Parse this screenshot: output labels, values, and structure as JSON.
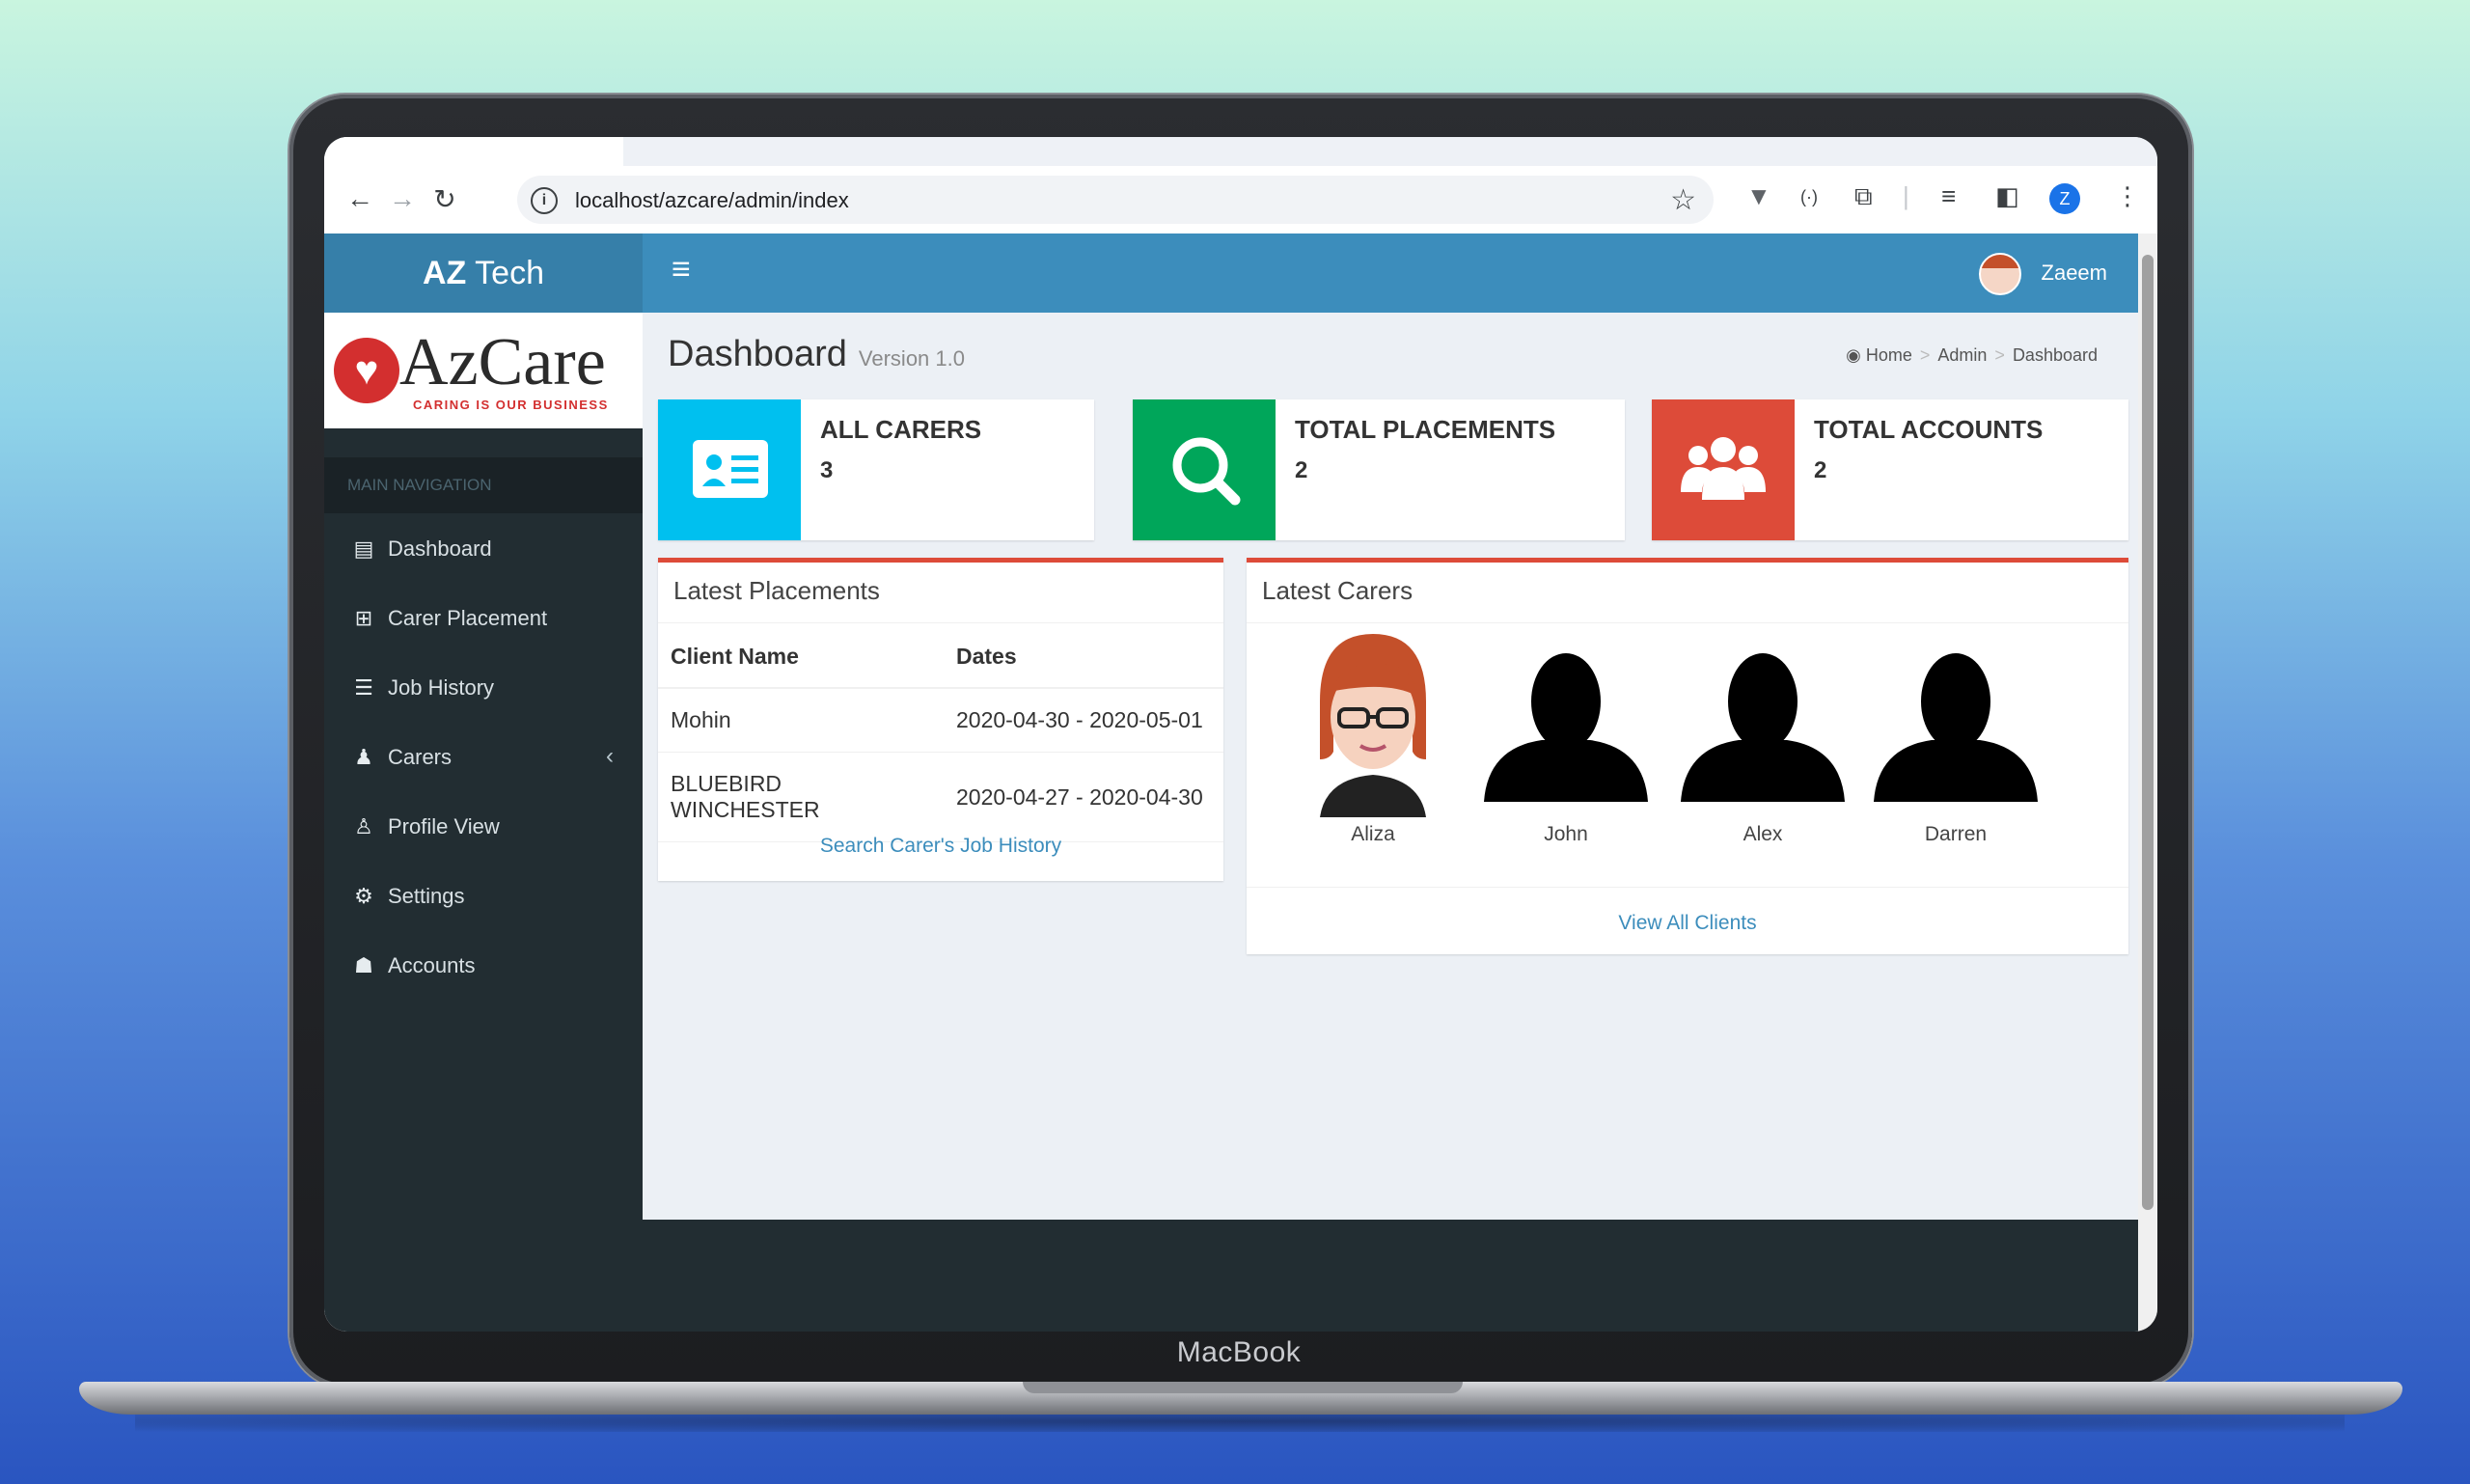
{
  "device": {
    "label": "MacBook"
  },
  "browser": {
    "url": "localhost/azcare/admin/index",
    "profile_initial": "Z"
  },
  "app": {
    "brand_bold": "AZ",
    "brand_rest": "Tech",
    "user_name": "Zaeem",
    "logo": {
      "name": "AzCare",
      "tagline": "CARING IS OUR BUSINESS"
    },
    "nav_header": "MAIN NAVIGATION",
    "menu": [
      {
        "label": "Dashboard",
        "icon": "book-icon"
      },
      {
        "label": "Carer Placement",
        "icon": "plus-square-icon"
      },
      {
        "label": "Job History",
        "icon": "list-icon"
      },
      {
        "label": "Carers",
        "icon": "user-icon",
        "has_caret": true
      },
      {
        "label": "Profile View",
        "icon": "user-secret-icon"
      },
      {
        "label": "Settings",
        "icon": "gear-icon"
      },
      {
        "label": "Accounts",
        "icon": "users-icon"
      }
    ],
    "page": {
      "title": "Dashboard",
      "subtitle": "Version 1.0"
    },
    "breadcrumb": [
      "Home",
      "Admin",
      "Dashboard"
    ],
    "info_boxes": [
      {
        "label": "ALL CARERS",
        "value": "3",
        "color": "#00c0ef",
        "icon": "id-card-icon"
      },
      {
        "label": "TOTAL PLACEMENTS",
        "value": "2",
        "color": "#00a65a",
        "icon": "search-icon"
      },
      {
        "label": "TOTAL ACCOUNTS",
        "value": "2",
        "color": "#dd4b39",
        "icon": "users-icon"
      }
    ],
    "placements": {
      "title": "Latest Placements",
      "columns": [
        "Client Name",
        "Dates"
      ],
      "rows": [
        [
          "Mohin",
          "2020-04-30 - 2020-05-01"
        ],
        [
          "BLUEBIRD WINCHESTER",
          "2020-04-27 - 2020-04-30"
        ]
      ],
      "footer_link": "Search Carer's Job History"
    },
    "carers": {
      "title": "Latest Carers",
      "people": [
        "Aliza",
        "John",
        "Alex",
        "Darren"
      ],
      "footer_link": "View All Clients"
    }
  }
}
